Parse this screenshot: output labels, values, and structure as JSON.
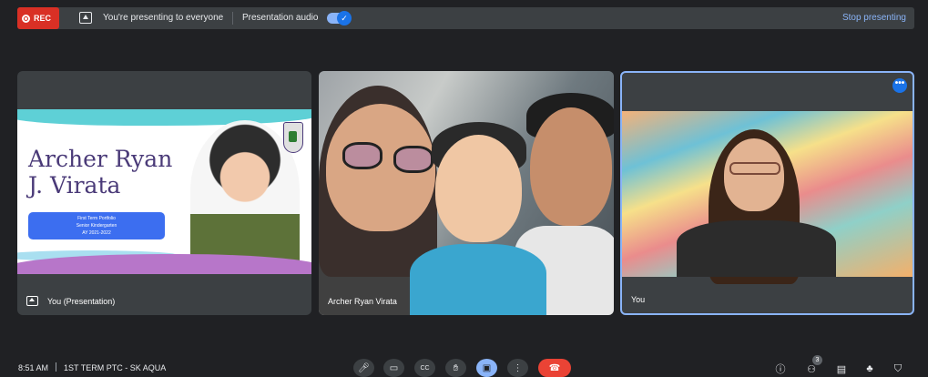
{
  "topbar": {
    "rec_label": "REC",
    "presenting_text": "You're presenting to everyone",
    "audio_label": "Presentation audio",
    "audio_toggle_on": true,
    "stop_label": "Stop presenting"
  },
  "tiles": [
    {
      "label": "You (Presentation)",
      "slide": {
        "name_line1": "Archer Ryan",
        "name_line2": "J. Virata",
        "box_line1": "First Term Portfolio",
        "box_line2": "Senior Kindergarten",
        "box_line3": "AY 2021-2022"
      }
    },
    {
      "label": "Archer Ryan Virata"
    },
    {
      "label": "You",
      "more_icon": "more-horiz-icon"
    }
  ],
  "bottombar": {
    "time": "8:51 AM",
    "meeting_name": "1ST TERM PTC - SK AQUA",
    "controls": [
      "mic-icon",
      "camera-icon",
      "captions-icon",
      "raise-hand-icon",
      "present-icon",
      "more-vert-icon",
      "end-call-icon"
    ],
    "right_icons": [
      "info-icon",
      "people-icon",
      "chat-icon",
      "activities-icon",
      "host-controls-icon"
    ],
    "participant_count": "3"
  },
  "colors": {
    "background": "#202124",
    "surface": "#3c4043",
    "accent": "#8ab4f8",
    "rec_red": "#d93025",
    "end_red": "#ea4335"
  }
}
